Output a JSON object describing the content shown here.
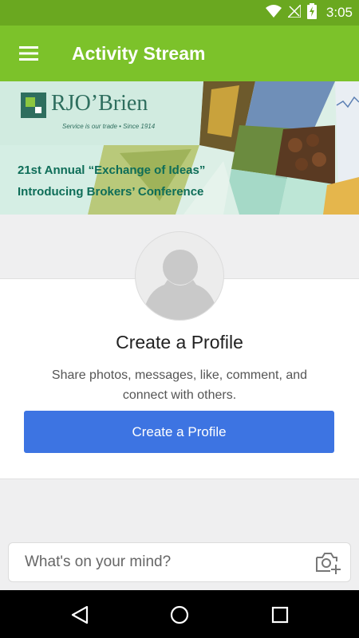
{
  "status_bar": {
    "time": "3:05",
    "icons": [
      "wifi-icon",
      "signal-off-icon",
      "battery-charging-icon"
    ]
  },
  "app_bar": {
    "title": "Activity Stream",
    "menu_icon": "hamburger-menu-icon"
  },
  "banner": {
    "logo_name": "RJO’Brien",
    "logo_tagline": "Service is our trade  •  Since 1914",
    "line1": "21st Annual “Exchange of Ideas”",
    "line2": "Introducing Brokers’ Conference"
  },
  "profile_card": {
    "title": "Create a Profile",
    "description": "Share photos, messages, like, comment, and connect with others.",
    "button_label": "Create a Profile"
  },
  "compose": {
    "placeholder": "What's on your mind?",
    "icon": "add-photo-icon"
  },
  "colors": {
    "status_bar": "#6aa820",
    "app_bar": "#7cc22a",
    "primary_button": "#3d74e2",
    "banner_text": "#0e6d58"
  }
}
